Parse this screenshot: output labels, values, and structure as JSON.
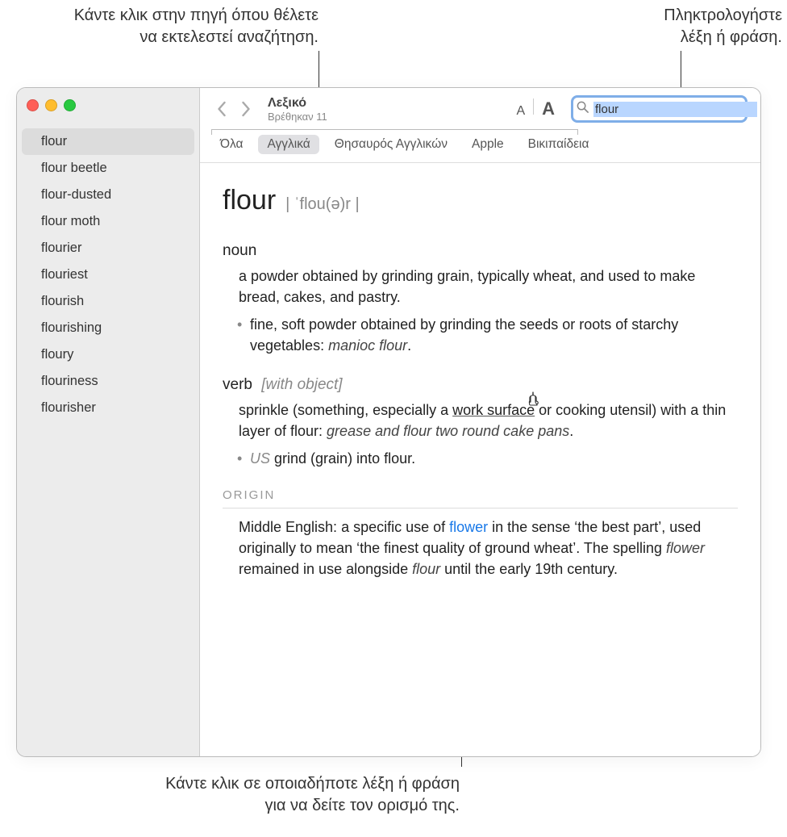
{
  "callouts": {
    "source": "Κάντε κλικ στην πηγή όπου θέλετε\nνα εκτελεστεί αναζήτηση.",
    "type": "Πληκτρολογήστε\nλέξη ή φράση.",
    "click_word": "Κάντε κλικ σε οποιαδήποτε λέξη ή φράση\nγια να δείτε τον ορισμό της."
  },
  "window": {
    "title": "Λεξικό",
    "subtitle": "Βρέθηκαν 11"
  },
  "search": {
    "value": "flour"
  },
  "sidebar": {
    "items": [
      "flour",
      "flour beetle",
      "flour-dusted",
      "flour moth",
      "flourier",
      "flouriest",
      "flourish",
      "flourishing",
      "floury",
      "flouriness",
      "flourisher"
    ],
    "selected": 0
  },
  "tabs": {
    "items": [
      "Όλα",
      "Αγγλικά",
      "Θησαυρός Αγγλικών",
      "Apple",
      "Βικιπαίδεια"
    ],
    "selected": 1
  },
  "entry": {
    "headword": "flour",
    "pronunciation": "| ˈflou(ə)r |",
    "senses": [
      {
        "pos": "noun",
        "gram": "",
        "def": "a powder obtained by grinding grain, typically wheat, and used to make bread, cakes, and pastry.",
        "subs": [
          {
            "prefix": "",
            "text": "fine, soft powder obtained by grinding the seeds or roots of starchy vegetables: ",
            "ex": "manioc flour",
            "suffix": "."
          }
        ]
      },
      {
        "pos": "verb",
        "gram": "[with object]",
        "def_pre": "sprinkle (something, especially a ",
        "def_link": "work surface",
        "def_post": " or cooking utensil) with a thin layer of flour: ",
        "def_ex": "grease and flour two round cake pans",
        "def_end": ".",
        "subs": [
          {
            "uslabel": "US",
            "text": " grind (grain) into flour."
          }
        ]
      }
    ],
    "origin_label": "ORIGIN",
    "origin_pre": "Middle English: a specific use of ",
    "origin_link": "flower",
    "origin_mid": " in the sense ‘the best part’, used originally to mean ‘the finest quality of ground wheat’. The spelling ",
    "origin_em1": "flower",
    "origin_mid2": " remained in use alongside ",
    "origin_em2": "flour",
    "origin_end": " until the early 19th century."
  }
}
